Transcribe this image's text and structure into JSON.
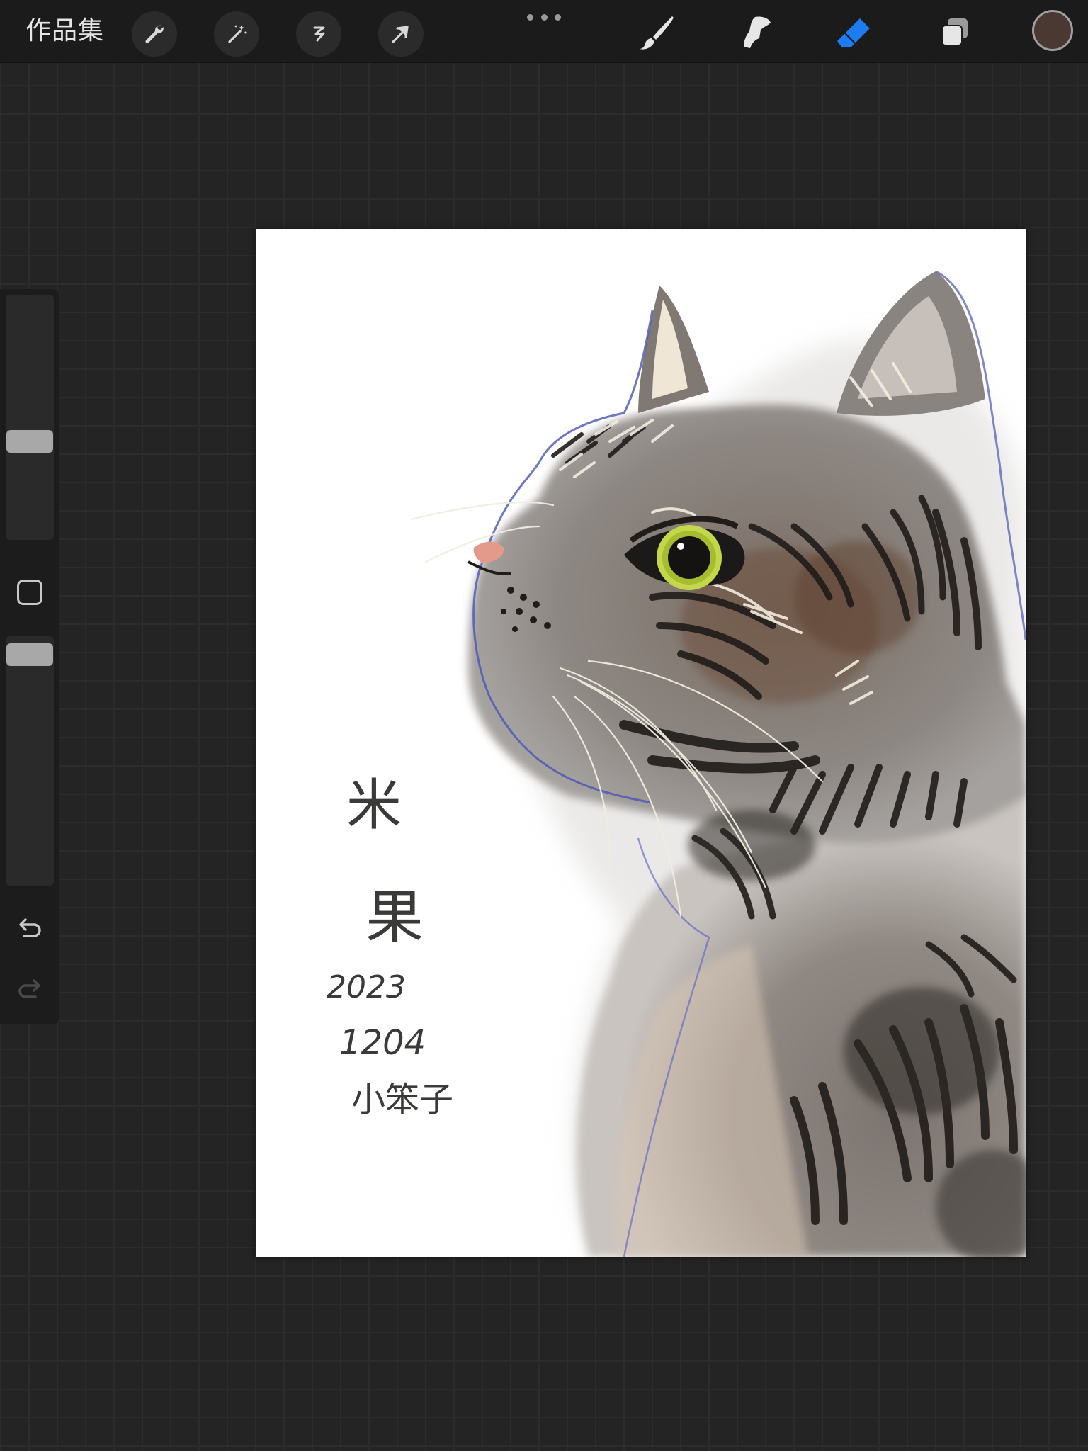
{
  "app": {
    "gallery_label": "作品集"
  },
  "toolbar": {
    "left_tools": [
      {
        "name": "wrench-icon",
        "label": "Actions"
      },
      {
        "name": "magic-wand-icon",
        "label": "Adjustments"
      },
      {
        "name": "selection-icon",
        "label": "Selection"
      },
      {
        "name": "transform-arrow-icon",
        "label": "Transform"
      }
    ],
    "right_tools": [
      {
        "name": "brush-icon",
        "label": "Paint",
        "active": false
      },
      {
        "name": "smudge-icon",
        "label": "Smudge",
        "active": false
      },
      {
        "name": "eraser-icon",
        "label": "Erase",
        "active": true
      },
      {
        "name": "layers-icon",
        "label": "Layers",
        "active": false
      }
    ],
    "current_color": "#4a3832",
    "active_tool_color": "#1d7cf2"
  },
  "sidebar": {
    "brush_size_level": 0.6,
    "opacity_level": 0.97
  },
  "canvas": {
    "artwork": {
      "subject": "tabby-cat-portrait",
      "inscription_line1": "米",
      "inscription_line2": "果",
      "inscription_year": "2023",
      "inscription_date": "1204",
      "inscription_artist": "小笨子"
    }
  }
}
